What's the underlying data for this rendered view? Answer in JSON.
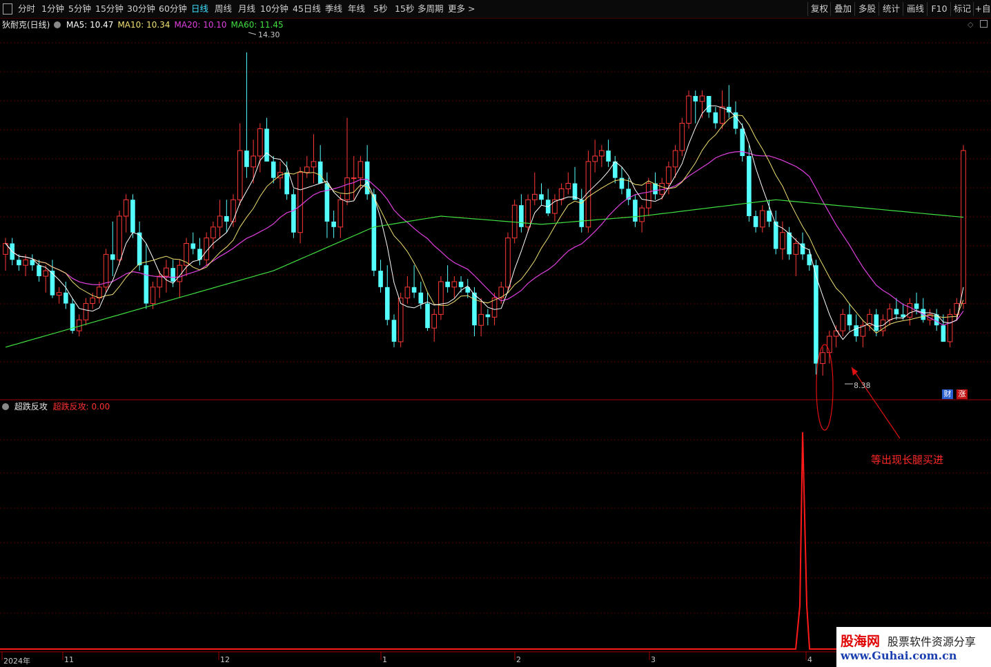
{
  "toolbar": {
    "periods": [
      "分时",
      "1分钟",
      "5分钟",
      "15分钟",
      "30分钟",
      "60分钟",
      "日线",
      "周线",
      "月线",
      "10分钟",
      "45日线",
      "季线",
      "年线",
      "5秒",
      "15秒",
      "多周期",
      "更多 >"
    ],
    "active_period": "日线",
    "right_buttons": [
      "复权",
      "叠加",
      "多股",
      "统计",
      "画线",
      "F10",
      "标记",
      "+自"
    ]
  },
  "main_panel": {
    "stock_title": "狄耐克(日线)",
    "ma_legend": [
      {
        "label": "MA5: 10.47",
        "color": "#ffffff"
      },
      {
        "label": "MA10: 10.34",
        "color": "#f0e070"
      },
      {
        "label": "MA20: 10.10",
        "color": "#e040e0"
      },
      {
        "label": "MA60: 11.45",
        "color": "#40e040"
      }
    ],
    "high_label": "14.30",
    "low_label": "8.38",
    "badges": [
      {
        "text": "财",
        "color": "#2a5fd0"
      },
      {
        "text": "涨",
        "color": "#c01010"
      }
    ]
  },
  "sub_panel": {
    "indicator_name": "超跌反攻",
    "indicator_value": "超跌反攻: 0.00",
    "annotation": "等出现长腿买进"
  },
  "x_axis": {
    "labels": [
      "2024年",
      "11",
      "12",
      "1",
      "2",
      "3",
      "4"
    ]
  },
  "watermark": {
    "brand": "股海网",
    "slogan": "股票软件资源分享",
    "url": "www.Guhai.com.cn"
  },
  "colors": {
    "up": "#ff3838",
    "down": "#54ffff",
    "bg": "#000000",
    "grid": "#5a0000",
    "ma5": "#ffffff",
    "ma10": "#f0e070",
    "ma20": "#e040e0",
    "ma60": "#40e040"
  },
  "chart_data": {
    "type": "candlestick",
    "y_range": [
      8.0,
      14.6
    ],
    "ohlc": [
      [
        10.6,
        10.9,
        10.3,
        10.8
      ],
      [
        10.8,
        10.9,
        10.4,
        10.5
      ],
      [
        10.5,
        10.6,
        10.3,
        10.4
      ],
      [
        10.4,
        10.6,
        10.2,
        10.5
      ],
      [
        10.5,
        10.6,
        10.3,
        10.4
      ],
      [
        10.4,
        10.5,
        10.1,
        10.2
      ],
      [
        10.2,
        10.4,
        9.9,
        10.3
      ],
      [
        10.3,
        10.5,
        9.8,
        9.85
      ],
      [
        9.85,
        10.0,
        9.7,
        9.9
      ],
      [
        9.9,
        10.1,
        9.6,
        9.7
      ],
      [
        9.7,
        9.8,
        9.15,
        9.2
      ],
      [
        9.2,
        9.5,
        9.1,
        9.4
      ],
      [
        9.4,
        9.8,
        9.3,
        9.7
      ],
      [
        9.7,
        9.9,
        9.6,
        9.8
      ],
      [
        9.8,
        10.1,
        9.7,
        10.0
      ],
      [
        10.0,
        10.7,
        9.9,
        10.6
      ],
      [
        10.6,
        11.2,
        10.2,
        10.5
      ],
      [
        10.5,
        11.4,
        10.4,
        11.3
      ],
      [
        11.3,
        11.7,
        11.0,
        11.6
      ],
      [
        11.6,
        11.7,
        10.9,
        11.0
      ],
      [
        11.0,
        11.2,
        10.3,
        10.4
      ],
      [
        10.4,
        10.8,
        9.6,
        9.7
      ],
      [
        9.7,
        10.1,
        9.6,
        10.0
      ],
      [
        10.0,
        10.3,
        9.8,
        10.2
      ],
      [
        10.2,
        10.5,
        9.9,
        10.35
      ],
      [
        10.35,
        10.5,
        10.0,
        10.1
      ],
      [
        10.1,
        10.5,
        9.8,
        10.4
      ],
      [
        10.4,
        10.9,
        10.2,
        10.8
      ],
      [
        10.8,
        11.0,
        10.6,
        10.7
      ],
      [
        10.7,
        10.9,
        10.4,
        10.5
      ],
      [
        10.5,
        11.0,
        10.4,
        10.9
      ],
      [
        10.9,
        11.2,
        10.7,
        11.1
      ],
      [
        11.1,
        11.6,
        10.9,
        11.3
      ],
      [
        11.3,
        11.6,
        11.0,
        11.2
      ],
      [
        11.2,
        11.7,
        11.1,
        11.6
      ],
      [
        11.6,
        13.0,
        11.5,
        12.5
      ],
      [
        12.5,
        14.3,
        12.0,
        12.2
      ],
      [
        12.2,
        12.7,
        11.9,
        12.4
      ],
      [
        12.4,
        13.0,
        12.1,
        12.9
      ],
      [
        12.9,
        13.1,
        12.5,
        12.3
      ],
      [
        12.3,
        12.4,
        11.9,
        12.0
      ],
      [
        12.0,
        12.3,
        11.8,
        12.1
      ],
      [
        12.1,
        12.3,
        11.6,
        11.7
      ],
      [
        11.7,
        11.8,
        10.9,
        11.0
      ],
      [
        11.0,
        12.2,
        10.8,
        12.1
      ],
      [
        12.1,
        12.4,
        12.0,
        12.2
      ],
      [
        12.2,
        12.8,
        11.9,
        12.3
      ],
      [
        12.3,
        12.6,
        11.9,
        11.9
      ],
      [
        11.9,
        12.1,
        10.9,
        11.2
      ],
      [
        11.2,
        11.4,
        10.9,
        11.1
      ],
      [
        11.1,
        11.7,
        10.9,
        11.6
      ],
      [
        11.6,
        13.1,
        11.5,
        12.0
      ],
      [
        12.0,
        12.4,
        11.6,
        12.0
      ],
      [
        12.0,
        12.4,
        11.8,
        12.3
      ],
      [
        12.3,
        12.6,
        11.6,
        11.7
      ],
      [
        11.7,
        11.8,
        10.2,
        10.3
      ],
      [
        10.3,
        10.5,
        9.9,
        10.0
      ],
      [
        10.0,
        10.4,
        9.3,
        9.4
      ],
      [
        9.4,
        9.5,
        8.9,
        9.0
      ],
      [
        9.0,
        9.9,
        8.9,
        9.8
      ],
      [
        9.8,
        10.2,
        9.7,
        10.0
      ],
      [
        10.0,
        10.4,
        9.8,
        9.9
      ],
      [
        9.9,
        10.1,
        9.6,
        9.7
      ],
      [
        9.7,
        9.9,
        9.2,
        9.25
      ],
      [
        9.25,
        9.6,
        9.0,
        9.5
      ],
      [
        9.5,
        10.2,
        9.4,
        10.1
      ],
      [
        10.1,
        10.4,
        9.9,
        10.0
      ],
      [
        10.0,
        10.2,
        9.8,
        10.1
      ],
      [
        10.1,
        10.2,
        9.9,
        10.0
      ],
      [
        10.0,
        10.15,
        9.8,
        9.9
      ],
      [
        9.9,
        10.0,
        9.1,
        9.3
      ],
      [
        9.3,
        9.8,
        9.1,
        9.5
      ],
      [
        9.5,
        9.6,
        9.3,
        9.45
      ],
      [
        9.45,
        9.9,
        9.3,
        9.8
      ],
      [
        9.8,
        10.1,
        9.7,
        10.0
      ],
      [
        10.0,
        11.0,
        9.9,
        10.9
      ],
      [
        10.9,
        11.6,
        10.8,
        11.5
      ],
      [
        11.5,
        11.7,
        11.0,
        11.1
      ],
      [
        11.1,
        11.7,
        11.0,
        11.6
      ],
      [
        11.6,
        12.1,
        11.5,
        11.7
      ],
      [
        11.7,
        11.9,
        11.5,
        11.6
      ],
      [
        11.6,
        11.8,
        11.3,
        11.35
      ],
      [
        11.35,
        11.7,
        11.2,
        11.6
      ],
      [
        11.6,
        11.9,
        11.5,
        11.8
      ],
      [
        11.8,
        12.1,
        11.7,
        11.9
      ],
      [
        11.9,
        12.2,
        11.7,
        11.6
      ],
      [
        11.6,
        11.8,
        11.0,
        11.1
      ],
      [
        11.1,
        12.5,
        11.0,
        12.3
      ],
      [
        12.3,
        12.7,
        12.1,
        12.4
      ],
      [
        12.4,
        12.6,
        12.2,
        12.5
      ],
      [
        12.5,
        12.7,
        12.2,
        12.3
      ],
      [
        12.3,
        12.4,
        11.9,
        12.0
      ],
      [
        12.0,
        12.2,
        11.7,
        11.8
      ],
      [
        11.8,
        12.0,
        11.5,
        11.6
      ],
      [
        11.6,
        11.7,
        11.1,
        11.2
      ],
      [
        11.2,
        11.5,
        11.0,
        11.45
      ],
      [
        11.45,
        12.0,
        11.3,
        11.9
      ],
      [
        11.9,
        12.1,
        11.6,
        11.7
      ],
      [
        11.7,
        12.0,
        11.6,
        11.9
      ],
      [
        11.9,
        12.3,
        11.7,
        12.2
      ],
      [
        12.2,
        12.6,
        12.0,
        12.5
      ],
      [
        12.5,
        13.1,
        12.4,
        13.0
      ],
      [
        13.0,
        13.6,
        12.9,
        13.5
      ],
      [
        13.5,
        13.6,
        13.0,
        13.4
      ],
      [
        13.4,
        13.6,
        13.1,
        13.5
      ],
      [
        13.5,
        13.5,
        13.1,
        13.2
      ],
      [
        13.2,
        13.3,
        12.9,
        13.0
      ],
      [
        13.0,
        13.6,
        12.9,
        13.3
      ],
      [
        13.3,
        13.7,
        13.1,
        13.2
      ],
      [
        13.2,
        13.4,
        12.8,
        12.9
      ],
      [
        12.9,
        13.0,
        12.3,
        12.4
      ],
      [
        12.4,
        12.6,
        11.2,
        11.3
      ],
      [
        11.3,
        11.4,
        11.0,
        11.1
      ],
      [
        11.1,
        11.5,
        11.0,
        11.4
      ],
      [
        11.4,
        11.6,
        11.1,
        11.2
      ],
      [
        11.2,
        11.4,
        10.6,
        10.7
      ],
      [
        10.7,
        11.2,
        10.5,
        11.0
      ],
      [
        11.0,
        11.1,
        10.5,
        10.6
      ],
      [
        10.6,
        10.9,
        10.2,
        10.8
      ],
      [
        10.8,
        11.0,
        10.5,
        10.6
      ],
      [
        10.6,
        10.7,
        10.3,
        10.4
      ],
      [
        10.4,
        10.5,
        8.4,
        8.6
      ],
      [
        8.6,
        8.9,
        8.38,
        8.8
      ],
      [
        8.8,
        9.2,
        8.6,
        9.1
      ],
      [
        9.1,
        9.3,
        8.9,
        9.2
      ],
      [
        9.2,
        9.6,
        9.1,
        9.5
      ],
      [
        9.5,
        9.7,
        9.2,
        9.3
      ],
      [
        9.3,
        9.5,
        9.0,
        9.1
      ],
      [
        9.1,
        9.4,
        8.9,
        9.3
      ],
      [
        9.3,
        9.6,
        9.2,
        9.5
      ],
      [
        9.5,
        9.6,
        9.1,
        9.2
      ],
      [
        9.2,
        9.5,
        9.1,
        9.4
      ],
      [
        9.4,
        9.7,
        9.3,
        9.6
      ],
      [
        9.6,
        9.8,
        9.4,
        9.5
      ],
      [
        9.5,
        9.7,
        9.4,
        9.45
      ],
      [
        9.45,
        9.8,
        9.3,
        9.7
      ],
      [
        9.7,
        9.9,
        9.5,
        9.6
      ],
      [
        9.6,
        9.8,
        9.35,
        9.4
      ],
      [
        9.4,
        9.6,
        9.3,
        9.5
      ],
      [
        9.5,
        9.6,
        9.2,
        9.3
      ],
      [
        9.3,
        9.5,
        9.0,
        9.0
      ],
      [
        9.0,
        9.6,
        8.9,
        9.5
      ],
      [
        9.5,
        9.8,
        9.4,
        9.7
      ],
      [
        9.7,
        12.6,
        9.6,
        12.5
      ]
    ],
    "ma60": [
      [
        0,
        8.9
      ],
      [
        20,
        9.6
      ],
      [
        40,
        10.3
      ],
      [
        55,
        11.1
      ],
      [
        65,
        11.3
      ],
      [
        80,
        11.15
      ],
      [
        95,
        11.3
      ],
      [
        115,
        11.6
      ],
      [
        150,
        11.2
      ]
    ],
    "indicator_values": {
      "spike_index": 119,
      "value": 100,
      "baseline": 0
    }
  }
}
